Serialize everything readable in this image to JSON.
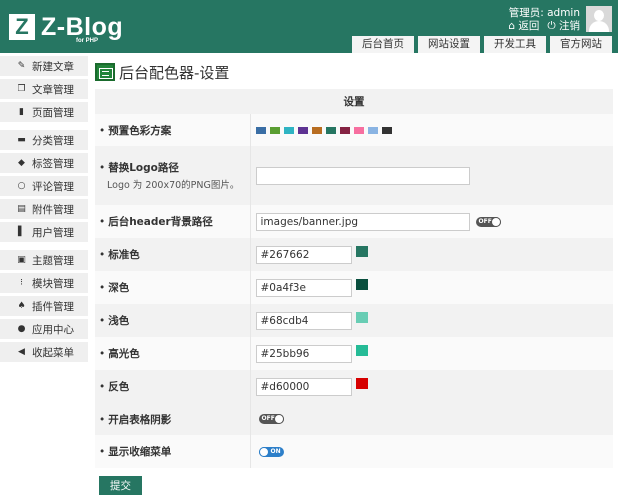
{
  "header": {
    "logo_mark": "Z",
    "logo_text": "Z-Blog",
    "logo_sub": "for PHP",
    "user_label": "管理员: admin",
    "back_label": "返回",
    "logout_label": "注销",
    "tabs": [
      "后台首页",
      "网站设置",
      "开发工具",
      "官方网站"
    ]
  },
  "sidebar": {
    "groups": [
      [
        {
          "label": "新建文章",
          "icon": "edit-icon",
          "glyph": "✎"
        },
        {
          "label": "文章管理",
          "icon": "articles-icon",
          "glyph": "❐"
        },
        {
          "label": "页面管理",
          "icon": "pages-icon",
          "glyph": "▮"
        }
      ],
      [
        {
          "label": "分类管理",
          "icon": "folder-icon",
          "glyph": "▬"
        },
        {
          "label": "标签管理",
          "icon": "tag-icon",
          "glyph": "◆"
        },
        {
          "label": "评论管理",
          "icon": "comment-icon",
          "glyph": "○"
        },
        {
          "label": "附件管理",
          "icon": "attachment-icon",
          "glyph": "▤"
        },
        {
          "label": "用户管理",
          "icon": "user-icon",
          "glyph": "▌"
        }
      ],
      [
        {
          "label": "主题管理",
          "icon": "theme-icon",
          "glyph": "▣"
        },
        {
          "label": "模块管理",
          "icon": "module-icon",
          "glyph": "⁝"
        },
        {
          "label": "插件管理",
          "icon": "plugin-icon",
          "glyph": "♠"
        },
        {
          "label": "应用中心",
          "icon": "app-center-icon",
          "glyph": "●"
        },
        {
          "label": "收起菜单",
          "icon": "collapse-icon",
          "glyph": "◀"
        }
      ]
    ]
  },
  "main": {
    "title": "后台配色器-设置",
    "table_header": "设置",
    "preset_label": "预置色彩方案",
    "preset_colors": [
      "#3a6ea5",
      "#5a9e32",
      "#2fb4c3",
      "#5e3393",
      "#b86d21",
      "#267662",
      "#852343",
      "#f76fa0",
      "#8ab4e3",
      "#333333"
    ],
    "logo_label": "替换Logo路径",
    "logo_hint": "Logo 为 200x70的PNG图片。",
    "logo_value": "",
    "bg_label": "后台header背景路径",
    "bg_value": "images/banner.jpg",
    "bg_toggle": "OFF",
    "colors": [
      {
        "label": "标准色",
        "value": "#267662",
        "swatch": "#267662"
      },
      {
        "label": "深色",
        "value": "#0a4f3e",
        "swatch": "#0a4f3e"
      },
      {
        "label": "浅色",
        "value": "#68cdb4",
        "swatch": "#68cdb4"
      },
      {
        "label": "高光色",
        "value": "#25bb96",
        "swatch": "#25bb96"
      },
      {
        "label": "反色",
        "value": "#d60000",
        "swatch": "#d60000"
      }
    ],
    "shadow_label": "开启表格阴影",
    "shadow_toggle": "OFF",
    "menu_label": "显示收缩菜单",
    "menu_toggle": "ON",
    "submit_label": "提交"
  }
}
